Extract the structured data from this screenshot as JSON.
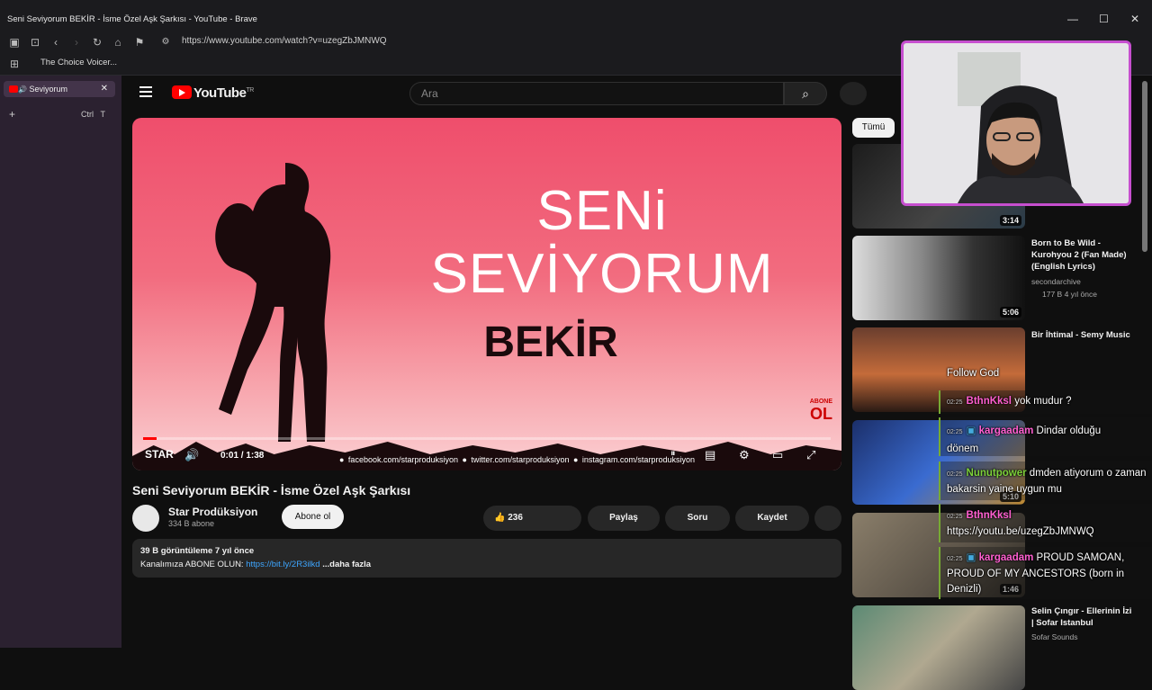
{
  "window": {
    "title": "Seni Seviyorum BEKİR - İsme Özel Aşk Şarkısı - YouTube - Brave"
  },
  "browser": {
    "url": "https://www.youtube.com/watch?v=uzegZbJMNWQ",
    "bookmark": "The Choice Voicer...",
    "tab_label": "Seviyorum",
    "new_tab_shortcut_ctrl": "Ctrl",
    "new_tab_shortcut_key": "T"
  },
  "youtube": {
    "logo_text": "YouTube",
    "logo_region": "TR",
    "search_placeholder": "Ara"
  },
  "video": {
    "title": "Seni Seviyorum BEKİR - İsme Özel Aşk Şarkısı",
    "thumb_line1": "SENi",
    "thumb_line2": "SEVİYORUM",
    "thumb_line3": "BEKİR",
    "abone_small": "ABONE",
    "abone_big": "OL",
    "time": "0:01 / 1:38",
    "progress_fraction": 0.01,
    "social": "● facebook.com/starproduksiyon   ● twitter.com/starproduksiyon   ● instagram.com/starproduksiyon",
    "brand": "STAR"
  },
  "channel": {
    "name": "Star Prodüksiyon",
    "subs": "334 B abone",
    "subscribe": "Abone ol"
  },
  "actions": {
    "likes": "236",
    "share": "Paylaş",
    "ask": "Soru",
    "save": "Kaydet"
  },
  "description": {
    "meta": "39 B görüntüleme  7 yıl önce",
    "text_prefix": "Kanalımıza ABONE OLUN: ",
    "link": "https://bit.ly/2R3ilkd",
    "more": " ...daha fazla"
  },
  "sidebar_chip": "Tümü",
  "recommendations": [
    {
      "title": "",
      "channel": "",
      "meta": "",
      "duration": "3:14"
    },
    {
      "title": "Born to Be Wild - Kurohyou 2 (Fan Made) (English Lyrics)",
      "channel": "secondarchive",
      "meta": "177 B  4 yıl önce",
      "duration": "5:06"
    },
    {
      "title": "Bir İhtimal - Semy Music",
      "channel": "",
      "meta": "",
      "duration": ""
    },
    {
      "title": "",
      "channel": "",
      "meta": "",
      "duration": "5:10"
    },
    {
      "title": "",
      "channel": "",
      "meta": "",
      "duration": "1:46"
    },
    {
      "title": "Selin Çıngır - Ellerinin İzi | Sofar Istanbul",
      "channel": "Sofar Sounds",
      "meta": "",
      "duration": ""
    }
  ],
  "chat": [
    {
      "time": "",
      "user": "",
      "text": "Follow God"
    },
    {
      "time": "02:25",
      "user": "BthnKksl",
      "text": " yok mudur ?"
    },
    {
      "time": "02:25",
      "user": "kargaadam",
      "text": " Dindar olduğu dönem"
    },
    {
      "time": "02:25",
      "user": "Nunutpower",
      "text": " dmden atiyorum o zaman bakarsin yaine uygun mu"
    },
    {
      "time": "02:25",
      "user": "BthnKksl",
      "text": " https://youtu.be/uzegZbJMNWQ"
    },
    {
      "time": "02:25",
      "user": "kargaadam",
      "text": " PROUD SAMOAN, PROUD OF MY ANCESTORS (born in Denizli)"
    }
  ],
  "colors": {
    "accent_red": "#ff0000",
    "chat_green": "#7dd13a",
    "chat_pink": "#ff5fd0",
    "webcam_border": "#c64fcf"
  }
}
